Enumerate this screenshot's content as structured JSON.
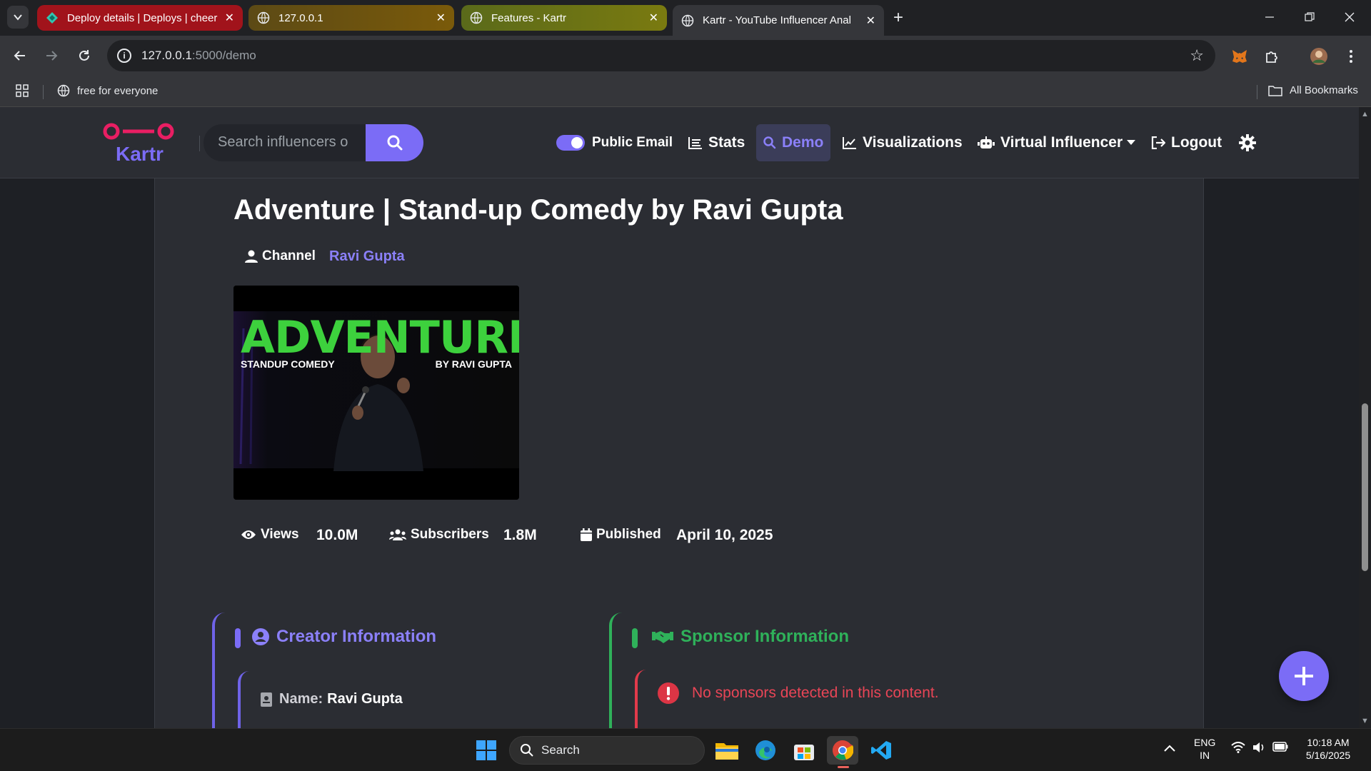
{
  "browser": {
    "tabs": [
      {
        "title": "Deploy details | Deploys | cheer",
        "favicon": "netlify-icon"
      },
      {
        "title": "127.0.0.1",
        "favicon": "globe-icon"
      },
      {
        "title": "Features - Kartr",
        "favicon": "globe-icon"
      },
      {
        "title": "Kartr - YouTube Influencer Anal",
        "favicon": "globe-icon"
      }
    ],
    "url_host": "127.0.0.1",
    "url_path": ":5000/demo",
    "bookmarks": {
      "item": "free for everyone",
      "all": "All Bookmarks"
    }
  },
  "nav": {
    "logo_text": "Kartr",
    "search_placeholder": "Search influencers o",
    "public_email": "Public Email",
    "stats": "Stats",
    "demo": "Demo",
    "visualizations": "Visualizations",
    "virtual_influencer": "Virtual Influencer",
    "logout": "Logout"
  },
  "video": {
    "title": "Adventure | Stand-up Comedy by Ravi Gupta",
    "channel_label": "Channel",
    "channel_name": "Ravi Gupta",
    "thumbnail": {
      "headline": "ADVENTURE",
      "left_caption": "STANDUP COMEDY",
      "right_caption": "BY RAVI GUPTA"
    },
    "views_label": "Views",
    "views_value": "10.0M",
    "subscribers_label": "Subscribers",
    "subscribers_value": "1.8M",
    "published_label": "Published",
    "published_value": "April 10, 2025"
  },
  "creator": {
    "heading": "Creator Information",
    "name_label": "Name:",
    "name_value": "Ravi Gupta"
  },
  "sponsor": {
    "heading": "Sponsor Information",
    "message": "No sponsors detected in this content."
  },
  "taskbar": {
    "search": "Search",
    "lang_top": "ENG",
    "lang_bottom": "IN",
    "time": "10:18 AM",
    "date": "5/16/2025"
  },
  "colors": {
    "accent": "#7b6cf6",
    "success": "#2fb15a",
    "danger": "#e23a4b",
    "logo_pink": "#e91e63"
  }
}
